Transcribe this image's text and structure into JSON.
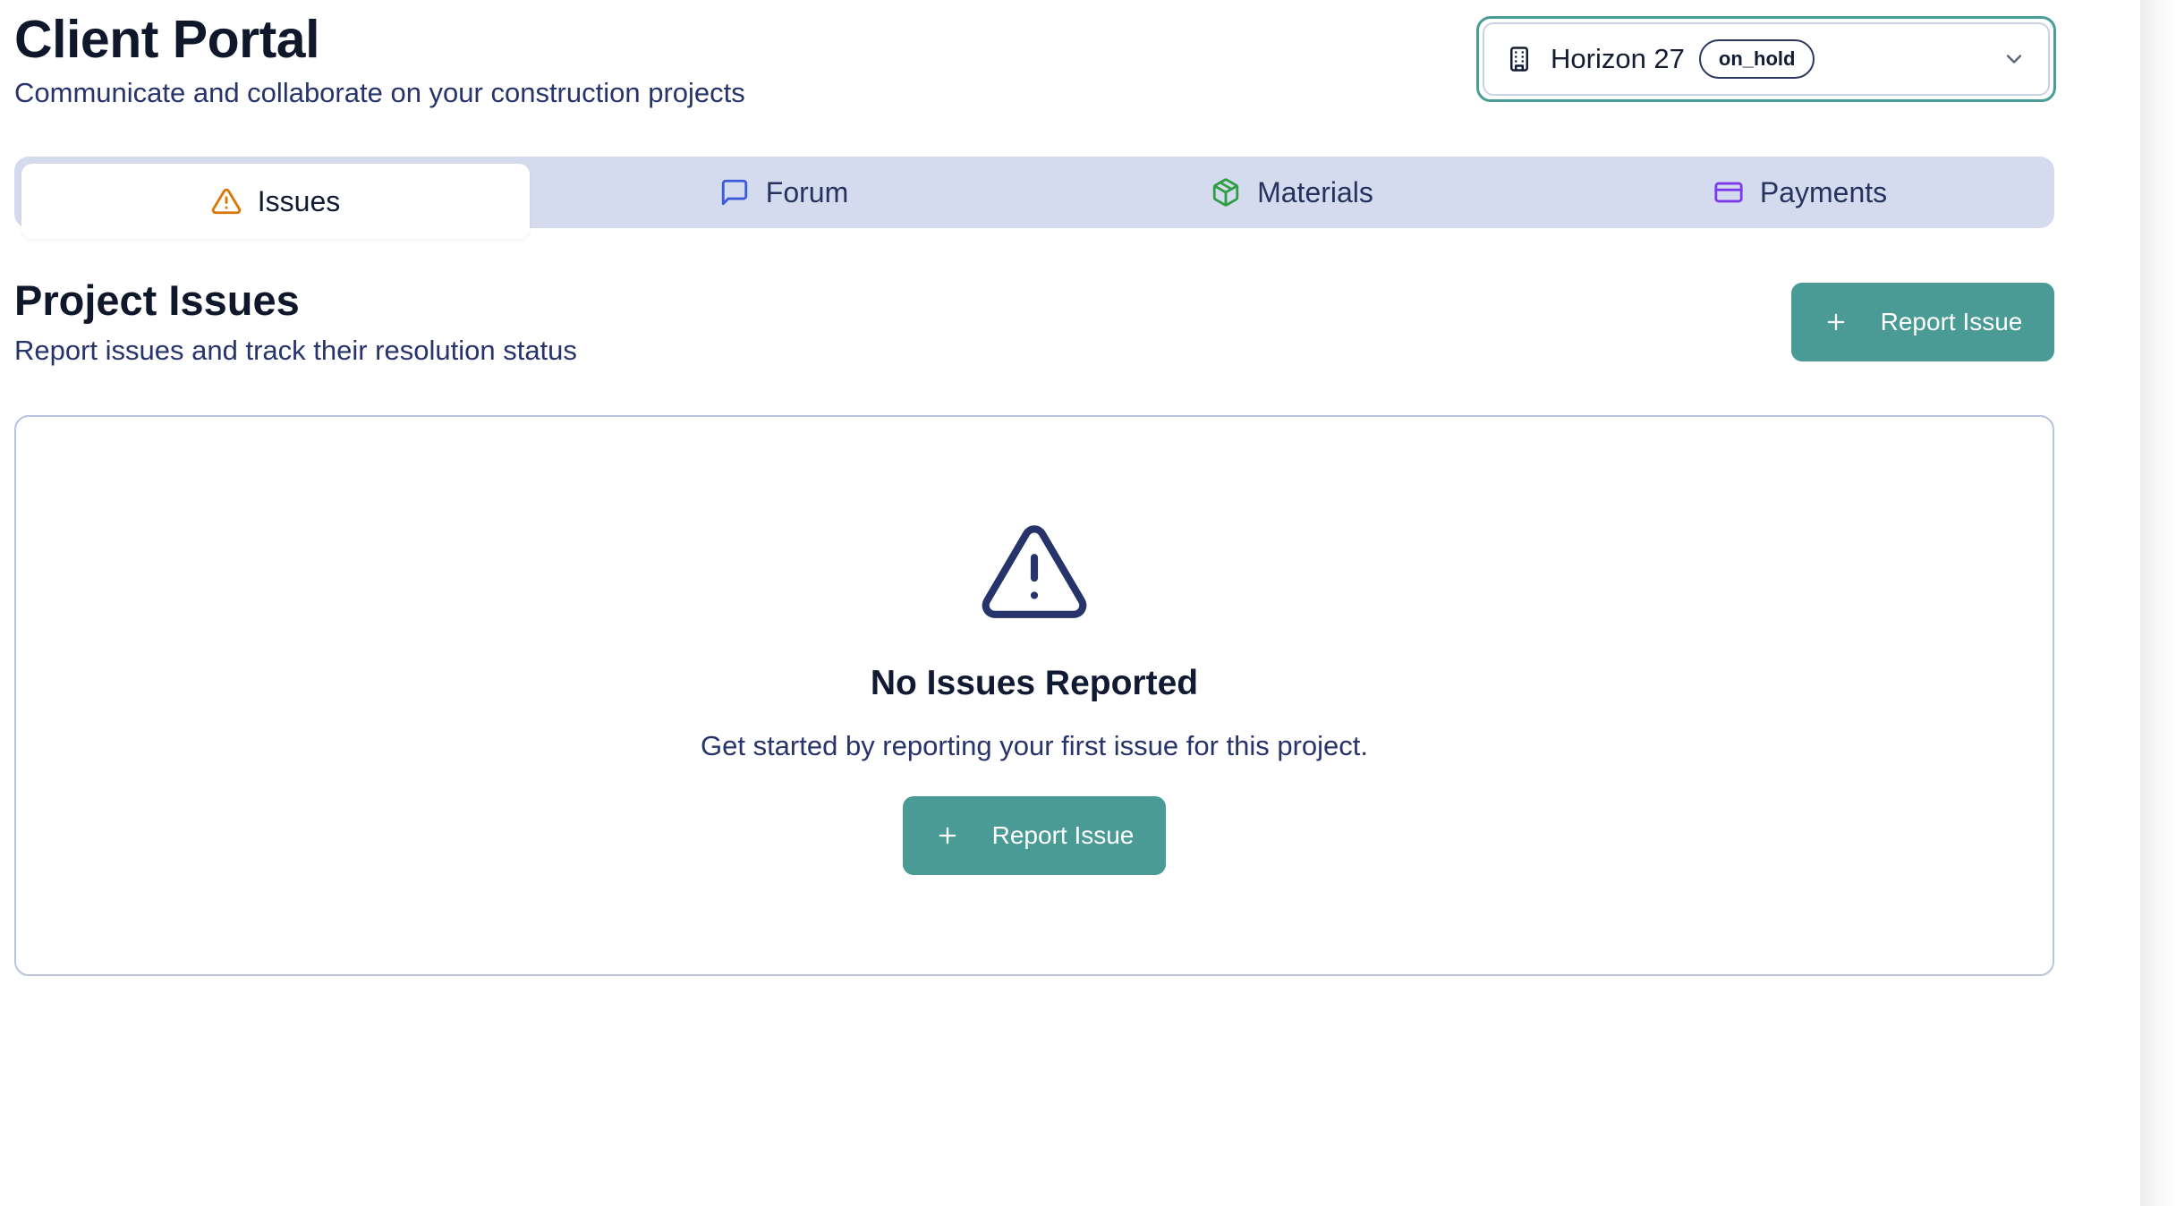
{
  "header": {
    "title": "Client Portal",
    "subtitle": "Communicate and collaborate on your construction projects"
  },
  "project_select": {
    "icon": "building-icon",
    "selected_project": "Horizon 27",
    "status": "on_hold",
    "accent_color": "#4a9c97"
  },
  "tabs": [
    {
      "label": "Issues",
      "icon": "alert-triangle-icon",
      "icon_color": "#d97706",
      "active": true
    },
    {
      "label": "Forum",
      "icon": "message-square-icon",
      "icon_color": "#3b5bdb",
      "active": false
    },
    {
      "label": "Materials",
      "icon": "package-icon",
      "icon_color": "#2f9e44",
      "active": false
    },
    {
      "label": "Payments",
      "icon": "credit-card-icon",
      "icon_color": "#7c3aed",
      "active": false
    }
  ],
  "section": {
    "title": "Project Issues",
    "subtitle": "Report issues and track their resolution status",
    "action_label": "Report Issue"
  },
  "empty_state": {
    "icon": "alert-triangle-icon",
    "title": "No Issues Reported",
    "text": "Get started by reporting your first issue for this project.",
    "action_label": "Report Issue"
  },
  "colors": {
    "primary_button": "#4a9a95",
    "tab_bar": "#d5dbee",
    "text_dark": "#0f172a",
    "text_muted": "#27346b"
  }
}
